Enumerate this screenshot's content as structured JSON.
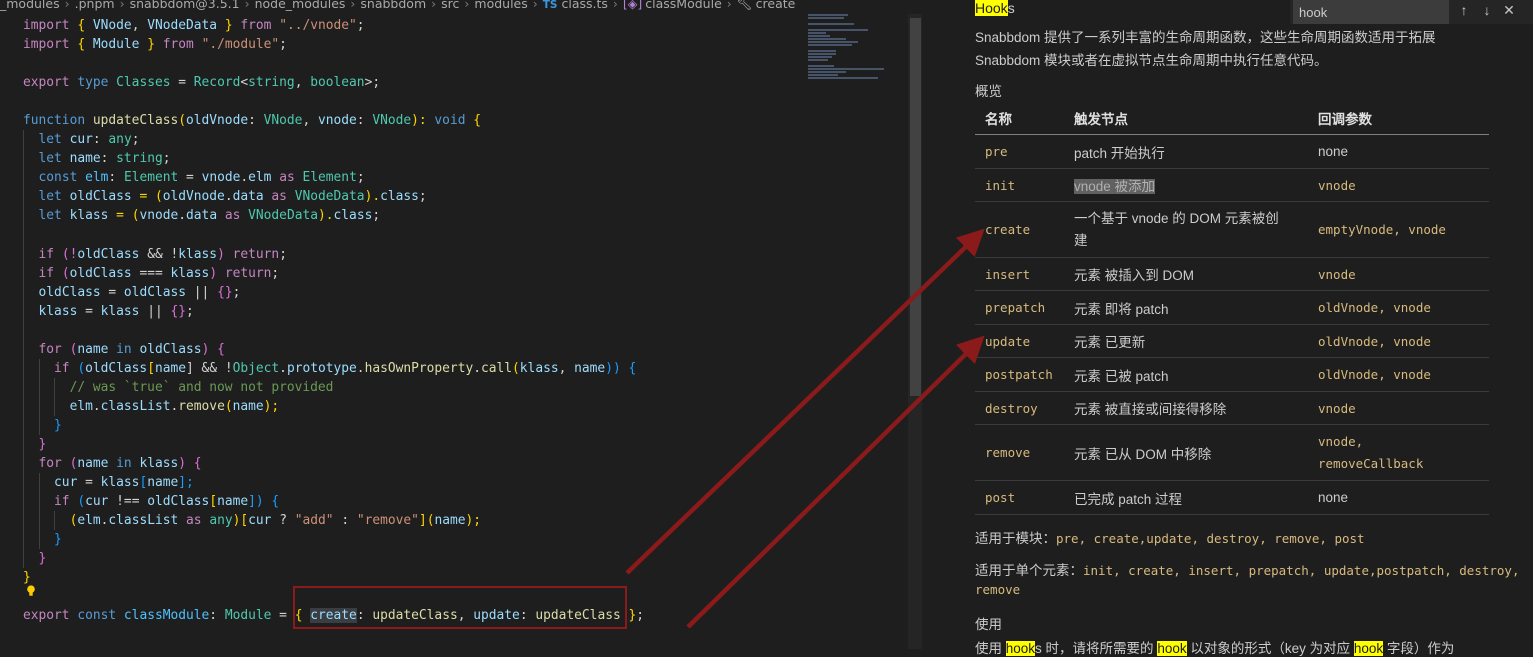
{
  "breadcrumb": {
    "items": [
      "_modules",
      ".pnpm",
      "snabbdom@3.5.1",
      "node_modules",
      "snabbdom",
      "src",
      "modules"
    ],
    "file_badge": "TS",
    "file": "class.ts",
    "symbol": "classModule",
    "symbol2": "create"
  },
  "code": {
    "l1": [
      "import",
      " { ",
      "VNode",
      ", ",
      "VNodeData",
      " } ",
      "from",
      " ",
      "\"../vnode\"",
      ";"
    ],
    "l2": [
      "import",
      " { ",
      "Module",
      " } ",
      "from",
      " ",
      "\"./module\"",
      ";"
    ],
    "l4": [
      "export",
      " ",
      "type",
      " ",
      "Classes",
      " = ",
      "Record",
      "<",
      "string",
      ", ",
      "boolean",
      ">;"
    ],
    "l6": [
      "function",
      " ",
      "updateClass",
      "(",
      "oldVnode",
      ": ",
      "VNode",
      ", ",
      "vnode",
      ": ",
      "VNode",
      "): ",
      "void",
      " {"
    ],
    "l7": [
      "let",
      " ",
      "cur",
      ": ",
      "any",
      ";"
    ],
    "l8": [
      "let",
      " ",
      "name",
      ": ",
      "string",
      ";"
    ],
    "l9": [
      "const",
      " ",
      "elm",
      ": ",
      "Element",
      " = ",
      "vnode",
      ".",
      "elm",
      " ",
      "as",
      " ",
      "Element",
      ";"
    ],
    "l10": [
      "let",
      " ",
      "oldClass",
      " = (",
      "oldVnode",
      ".",
      "data",
      " ",
      "as",
      " ",
      "VNodeData",
      ").",
      "class",
      ";"
    ],
    "l11": [
      "let",
      " ",
      "klass",
      " = (",
      "vnode",
      ".",
      "data",
      " ",
      "as",
      " ",
      "VNodeData",
      ").",
      "class",
      ";"
    ],
    "l13": [
      "if",
      " (!",
      "oldClass",
      " && !",
      "klass",
      ") ",
      "return",
      ";"
    ],
    "l14": [
      "if",
      " (",
      "oldClass",
      " === ",
      "klass",
      ") ",
      "return",
      ";"
    ],
    "l15": [
      "oldClass",
      " = ",
      "oldClass",
      " || ",
      "{}",
      ";"
    ],
    "l16": [
      "klass",
      " = ",
      "klass",
      " || ",
      "{}",
      ";"
    ],
    "l18": [
      "for",
      " (",
      "name",
      " ",
      "in",
      " ",
      "oldClass",
      ") {"
    ],
    "l19": [
      "if",
      " (",
      "oldClass",
      "[",
      "name",
      "] && !",
      "Object",
      ".",
      "prototype",
      ".",
      "hasOwnProperty",
      ".",
      "call",
      "(",
      "klass",
      ", ",
      "name",
      ")) {"
    ],
    "l20": "// was `true` and now not provided",
    "l21": [
      "elm",
      ".",
      "classList",
      ".",
      "remove",
      "(",
      "name",
      ");"
    ],
    "l22": "}",
    "l23": "}",
    "l24": [
      "for",
      " (",
      "name",
      " ",
      "in",
      " ",
      "klass",
      ") {"
    ],
    "l25": [
      "cur",
      " = ",
      "klass",
      "[",
      "name",
      "];"
    ],
    "l26": [
      "if",
      " (",
      "cur",
      " !== ",
      "oldClass",
      "[",
      "name",
      "]) {"
    ],
    "l27": [
      "(",
      "elm",
      ".",
      "classList",
      " ",
      "as",
      " ",
      "any",
      ")[",
      "cur",
      " ? ",
      "\"add\"",
      " : ",
      "\"remove\"",
      "](",
      "name",
      ");"
    ],
    "l28": "}",
    "l29": "}",
    "l30": "}",
    "l32": [
      "export",
      " ",
      "const",
      " ",
      "classModule",
      ": ",
      "Module",
      " = ",
      "{",
      " ",
      "create",
      ": ",
      "updateClass",
      ", ",
      "update",
      ": ",
      "updateClass",
      " ",
      "}",
      ";"
    ]
  },
  "find": {
    "value": "hook",
    "up": "↑",
    "down": "↓",
    "close": "✕"
  },
  "doc": {
    "heading_mark": "Hook",
    "heading_rest": "s",
    "intro1": "Snabbdom 提供了一系列丰富的生命周期函数，这些生命周期函数适用于拓展",
    "intro2": "Snabbdom 模块或者在虚拟节点生命周期中执行任意代码。",
    "overview": "概览",
    "headers": [
      "名称",
      "触发节点",
      "回调参数"
    ],
    "rows": [
      {
        "name": "pre",
        "trigger": "patch 开始执行",
        "args": "none"
      },
      {
        "name": "init",
        "trigger": "vnode 被添加",
        "args": "vnode"
      },
      {
        "name": "create",
        "trigger": "一个基于 vnode 的 DOM 元素被创",
        "trigger2": "建",
        "args": "emptyVnode, vnode"
      },
      {
        "name": "insert",
        "trigger": "元素 被插入到 DOM",
        "args": "vnode"
      },
      {
        "name": "prepatch",
        "trigger": "元素 即将 patch",
        "args": "oldVnode, vnode"
      },
      {
        "name": "update",
        "trigger": "元素 已更新",
        "args": "oldVnode, vnode"
      },
      {
        "name": "postpatch",
        "trigger": "元素 已被 patch",
        "args": "oldVnode, vnode"
      },
      {
        "name": "destroy",
        "trigger": "元素 被直接或间接得移除",
        "args": "vnode"
      },
      {
        "name": "remove",
        "trigger": "元素 已从 DOM 中移除",
        "args": "vnode,",
        "args2": "removeCallback"
      },
      {
        "name": "post",
        "trigger": "已完成 patch 过程",
        "args": "none"
      }
    ],
    "modules_label": "适用于模块：",
    "modules_list": "pre, create,update, destroy, remove, post",
    "elements_label": "适用于单个元素：",
    "elements_list": "init, create, insert, prepatch, update,postpatch, destroy,",
    "elements_list2": "remove",
    "usage": "使用",
    "usage_p1": "使用 ",
    "usage_m1": "hook",
    "usage_p2": "s 时，请将所需要的 ",
    "usage_m2": "hook",
    "usage_p3": " 以对象的形式（key 为对应 ",
    "usage_m3": "hook",
    "usage_p4": " 字段）作为"
  },
  "colors": {
    "annotation": "#8b1a1a",
    "find_mark": "#ffff00"
  }
}
